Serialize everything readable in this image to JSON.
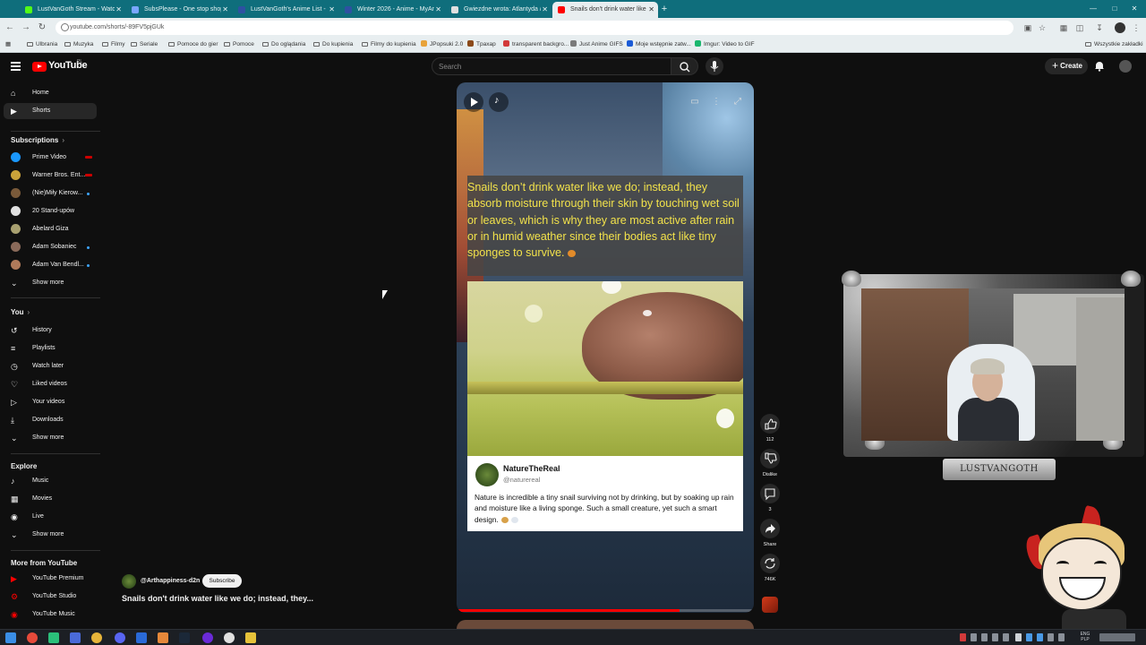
{
  "browser": {
    "tabs": [
      {
        "title": "LustVanGoth Stream - Watch L",
        "favicon_color": "#53fc18"
      },
      {
        "title": "SubsPlease - One stop shop fo",
        "favicon_color": "#7aa6ff"
      },
      {
        "title": "LustVanGoth's Anime List - My",
        "favicon_color": "#2e51a2"
      },
      {
        "title": "Winter 2026 - Anime - MyAnim",
        "favicon_color": "#2e51a2"
      },
      {
        "title": "Gwiezdne wrota: Atlantyda / Si",
        "favicon_color": "#e0e0e0"
      },
      {
        "title": "Snails don't drink water like we",
        "favicon_color": "#ff0000",
        "active": true
      }
    ],
    "url": "youtube.com/shorts/-89FV5pjGUk",
    "bookmarks": [
      {
        "label": "Ulbrania",
        "kind": "folder"
      },
      {
        "label": "Muzyka",
        "kind": "folder"
      },
      {
        "label": "Filmy",
        "kind": "folder"
      },
      {
        "label": "Seriale",
        "kind": "folder"
      },
      {
        "label": "Pomoce do gier",
        "kind": "folder"
      },
      {
        "label": "Pomoce",
        "kind": "folder"
      },
      {
        "label": "Do oglądania",
        "kind": "folder"
      },
      {
        "label": "Do kupienia",
        "kind": "folder"
      },
      {
        "label": "Filmy do kupienia",
        "kind": "folder"
      },
      {
        "label": "JPopsuki 2.0",
        "kind": "site",
        "color": "#e8a33a"
      },
      {
        "label": "Tpaxap",
        "kind": "site",
        "color": "#8b4a1a"
      },
      {
        "label": "transparent backgro...",
        "kind": "site",
        "color": "#d23a3a"
      },
      {
        "label": "Just Anime GIFS",
        "kind": "site",
        "color": "#7a7a7a"
      },
      {
        "label": "Moje wstępnie zatw...",
        "kind": "site",
        "color": "#1b5bd6"
      },
      {
        "label": "Imgur: Video to GIF",
        "kind": "site",
        "color": "#1bb76e"
      }
    ],
    "bookmarks_all": "Wszystkie zakładki"
  },
  "youtube": {
    "logo_text": "YouTube",
    "country_code": "PL",
    "search_placeholder": "Search",
    "create_label": "Create",
    "sidebar": {
      "main": [
        {
          "label": "Home",
          "icon": "home-icon"
        },
        {
          "label": "Shorts",
          "icon": "shorts-icon",
          "active": true
        }
      ],
      "subscriptions_heading": "Subscriptions",
      "subscriptions": [
        {
          "label": "Prime Video",
          "avatar_color": "#1a98ff",
          "badge": "live"
        },
        {
          "label": "Warner Bros. Ent...",
          "avatar_color": "#c9a23a",
          "badge": "live"
        },
        {
          "label": "(Nie)Miły Kierow...",
          "avatar_color": "#7a5a3a",
          "badge": "dot"
        },
        {
          "label": "20 Stand-upów",
          "avatar_color": "#e0e0e0",
          "badge": ""
        },
        {
          "label": "Abelard Giza",
          "avatar_color": "#a8a070",
          "badge": ""
        },
        {
          "label": "Adam Sobaniec",
          "avatar_color": "#8a6a5a",
          "badge": "dot"
        },
        {
          "label": "Adam Van Bendl...",
          "avatar_color": "#b07a5a",
          "badge": "dot"
        }
      ],
      "subs_show_more": "Show more",
      "you_heading": "You",
      "you_items": [
        {
          "label": "History",
          "icon": "history-icon"
        },
        {
          "label": "Playlists",
          "icon": "playlists-icon"
        },
        {
          "label": "Watch later",
          "icon": "watch-later-icon"
        },
        {
          "label": "Liked videos",
          "icon": "liked-videos-icon"
        },
        {
          "label": "Your videos",
          "icon": "your-videos-icon"
        },
        {
          "label": "Downloads",
          "icon": "downloads-icon"
        }
      ],
      "you_show_more": "Show more",
      "explore_heading": "Explore",
      "explore_items": [
        {
          "label": "Music",
          "icon": "music-icon"
        },
        {
          "label": "Movies",
          "icon": "movies-icon"
        },
        {
          "label": "Live",
          "icon": "live-icon"
        }
      ],
      "explore_show_more": "Show more",
      "more_heading": "More from YouTube",
      "more_items": [
        {
          "label": "YouTube Premium",
          "icon": "youtube-premium-icon"
        },
        {
          "label": "YouTube Studio",
          "icon": "youtube-studio-icon"
        },
        {
          "label": "YouTube Music",
          "icon": "youtube-music-icon"
        }
      ]
    },
    "short": {
      "caption": "Snails don’t drink water like we do; instead, they absorb moisture through their skin by touching wet soil or leaves, which is why they are most active after rain or in humid weather since their bodies act like tiny sponges to survive.",
      "card_name": "NatureTheReal",
      "card_handle": "@naturereal",
      "card_text": "Nature is incredible a tiny snail surviving not by drinking, but by soaking up rain and moisture like a living sponge. Such a small creature, yet such a smart design.",
      "progress_fraction": 0.75,
      "channel_handle": "@Arthappiness-d2n",
      "subscribe_label": "Subscribe",
      "title": "Snails don't drink water like we do; instead, they..."
    },
    "actions": {
      "like_count": "112",
      "dislike_label": "Dislike",
      "comment_count": "3",
      "share_label": "Share",
      "remix_count": "746K"
    }
  },
  "stream_overlay": {
    "nameplate": "LUSTVANGOTH"
  },
  "taskbar": {
    "lang": "ENG",
    "lang2": "PLP"
  }
}
